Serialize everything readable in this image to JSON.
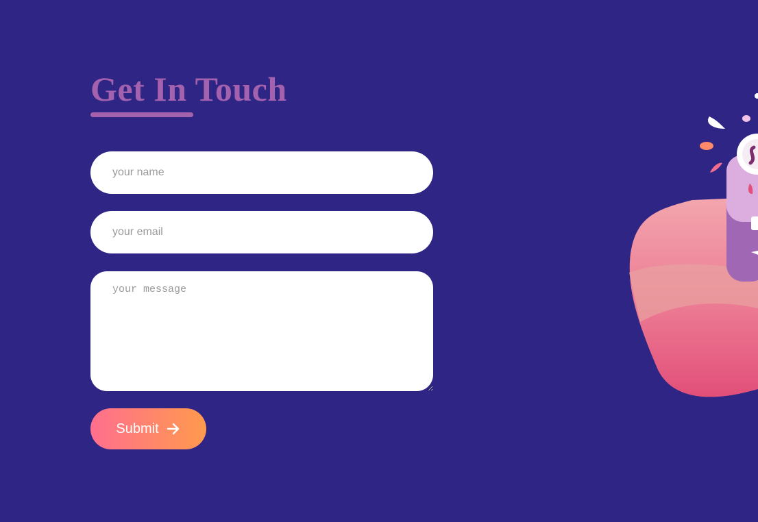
{
  "contact": {
    "heading": "Get In Touch",
    "name_placeholder": "your name",
    "email_placeholder": "your email",
    "message_placeholder": "your message",
    "submit_label": "Submit"
  },
  "icons": {
    "submit_icon": "arrow-right-icon"
  },
  "colors": {
    "background": "#2e2585",
    "heading": "#a461ad",
    "button_gradient_start": "#ff6f8e",
    "button_gradient_end": "#ff9a4d",
    "field_background": "#ffffff"
  }
}
